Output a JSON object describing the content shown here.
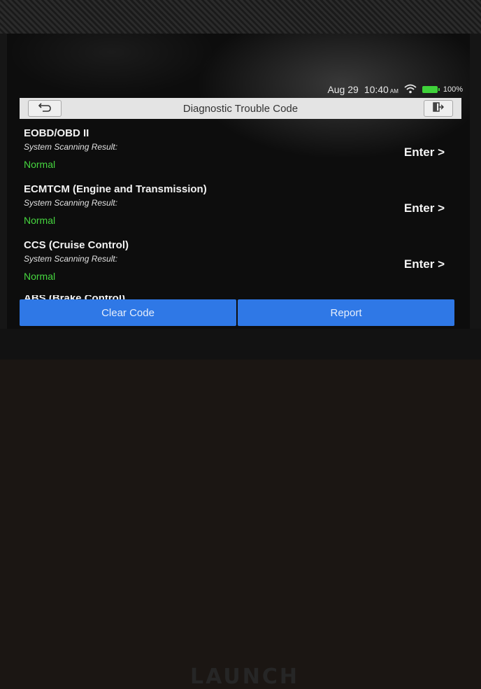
{
  "status_bar": {
    "date": "Aug 29",
    "time": "10:40",
    "ampm": "AM",
    "battery": "100%"
  },
  "header": {
    "title": "Diagnostic Trouble Code"
  },
  "systems": [
    {
      "name": "EOBD/OBD II",
      "label": "System Scanning Result:",
      "status": "Normal",
      "action": "Enter >"
    },
    {
      "name": "ECMTCM (Engine and Transmission)",
      "label": "System Scanning Result:",
      "status": "Normal",
      "action": "Enter >"
    },
    {
      "name": "CCS (Cruise Control)",
      "label": "System Scanning Result:",
      "status": "Normal",
      "action": "Enter >"
    },
    {
      "name": "ABS (Brake Control)"
    }
  ],
  "footer": {
    "clear_code": "Clear Code",
    "report": "Report"
  },
  "device": {
    "brand": "LAUNCH"
  },
  "colors": {
    "accent": "#2f78e6",
    "status_ok": "#46d63f",
    "battery": "#3fd23a",
    "header_bg": "#e4e4e4"
  },
  "icons": {
    "back": "back-arrow-icon",
    "exit": "exit-icon",
    "wifi": "wifi-icon",
    "battery": "battery-icon"
  }
}
